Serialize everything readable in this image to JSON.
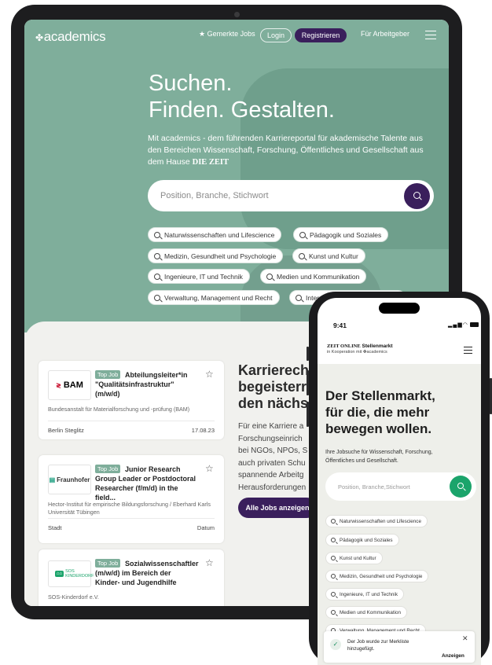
{
  "tablet": {
    "nav": {
      "logo": "academics",
      "saved_jobs": "Gemerkte Jobs",
      "login": "Login",
      "register": "Registrieren",
      "for_employers": "Für Arbeitgeber"
    },
    "hero": {
      "title_line1": "Suchen.",
      "title_line2": "Finden. Gestalten.",
      "description": "Mit academics - dem führenden Karriereportal für akademische Talente aus den Bereichen Wissenschaft, Forschung, Öffentliches und Gesellschaft aus dem Hause",
      "description_brand": "DIE ZEIT",
      "search_placeholder": "Position, Branche, Stichwort"
    },
    "chips": [
      "Naturwissenschaften und Lifescience",
      "Pädagogik und Soziales",
      "Medizin, Gesundheit und Psychologie",
      "Kunst und Kultur",
      "Ingenieure, IT und Technik",
      "Medien und Kommunikation",
      "Verwaltung, Management und Recht",
      "Internationale Zusammenarbeit"
    ],
    "jobs": [
      {
        "logo": "BAM",
        "badge": "Top Job",
        "title": "Abteilungsleiter*in \"Qualitätsinfrastruktur\" (m/w/d)",
        "employer": "Bundesanstalt für Materialforschung und -prüfung (BAM)",
        "location": "Berlin Steglitz",
        "date": "17.08.23"
      },
      {
        "logo": "Fraunhofer",
        "badge": "Top Job",
        "title": "Junior Research Group Leader or Postdoctoral Researcher (f/m/d) in the field...",
        "employer": "Hector-Institut für empirische Bildungsforschung / Eberhard Karls Universität Tübingen",
        "location": "Stadt",
        "date": "Datum"
      },
      {
        "logo": "SOS KINDERDORF",
        "badge": "Top Job",
        "title": "Sozialwissenschaftler (m/w/d) im Bereich der Kinder- und Jugendhilfe",
        "employer": "SOS-Kinderdorf e.V."
      }
    ],
    "career": {
      "title_lines": [
        "Karrierech",
        "begeisterr",
        "den nächs"
      ],
      "text_lines": [
        "Für eine Karriere a",
        "Forschungseinrich",
        "bei NGOs, NPOs, S",
        "auch privaten Schu",
        "spannende Arbeitg",
        "Herausforderungen"
      ],
      "all_jobs_button": "Alle Jobs anzeigen"
    }
  },
  "phone": {
    "status_time": "9:41",
    "brand_zeit": "ZEIT ONLINE",
    "brand_stellenmarkt": "Stellenmarkt",
    "brand_coop": "in Kooperation mit",
    "brand_logo": "academics",
    "title_lines": [
      "Der Stellenmarkt,",
      "für die, die mehr",
      "bewegen wollen."
    ],
    "desc_lines": [
      "Ihre Jobsuche für Wissenschaft, Forschung,",
      "Öffentliches und Gesellschaft."
    ],
    "search_placeholder": "Position, Branche,Stichwort",
    "chips": [
      "Naturwissenschaften und Lifescience",
      "Pädagogik und Soziales",
      "Kunst und Kultur",
      "Medizin, Gesundheit und Psychologie",
      "Ingenieure, IT und Technik",
      "Medien und Kommunikation",
      "Verwaltung, Management und Recht"
    ],
    "toast": {
      "message": "Der Job wurde zur Merkliste hinzugefügt.",
      "action": "Anzeigen"
    }
  }
}
